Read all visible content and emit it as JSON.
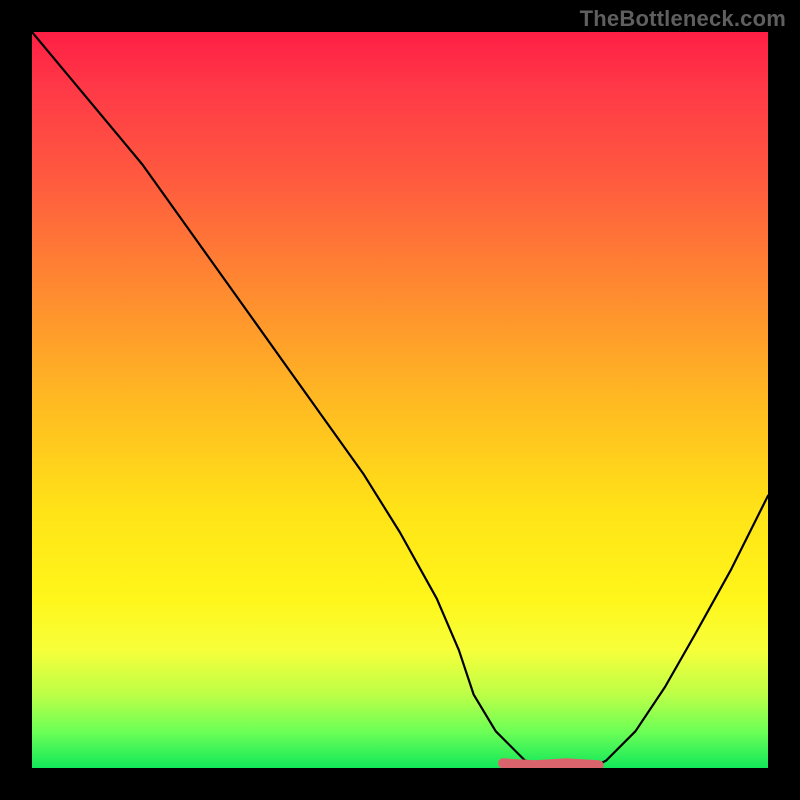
{
  "watermark": "TheBottleneck.com",
  "chart_data": {
    "type": "line",
    "title": "",
    "xlabel": "",
    "ylabel": "",
    "xlim": [
      0,
      100
    ],
    "ylim": [
      0,
      100
    ],
    "series": [
      {
        "name": "bottleneck-curve",
        "x": [
          0,
          5,
          10,
          15,
          20,
          25,
          30,
          35,
          40,
          45,
          50,
          55,
          58,
          60,
          63,
          67,
          72,
          76,
          78,
          82,
          86,
          90,
          95,
          100
        ],
        "y": [
          100,
          94,
          88,
          82,
          75,
          68,
          61,
          54,
          47,
          40,
          32,
          23,
          16,
          10,
          5,
          1,
          0,
          0,
          1,
          5,
          11,
          18,
          27,
          37
        ]
      }
    ],
    "highlight_segments": [
      {
        "name": "trough-highlight",
        "x_start": 64,
        "x_end": 77,
        "y": 0.5
      }
    ],
    "gradient_stops": [
      {
        "pos": 0,
        "color": "#ff1f45"
      },
      {
        "pos": 35,
        "color": "#ff8a30"
      },
      {
        "pos": 65,
        "color": "#ffe317"
      },
      {
        "pos": 90,
        "color": "#bdff47"
      },
      {
        "pos": 100,
        "color": "#12e85a"
      }
    ]
  }
}
